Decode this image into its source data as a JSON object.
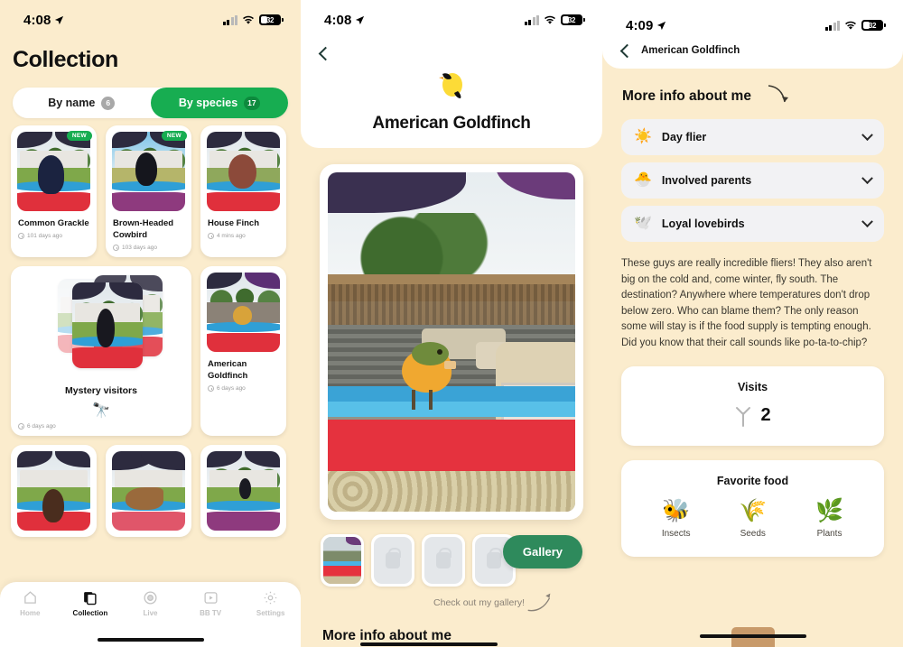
{
  "status_bar": {
    "time_left": "4:08",
    "time_mid": "4:08",
    "time_right": "4:09",
    "battery": "32",
    "location_icon": "location-arrow-icon",
    "signal_icon": "cellular-bars-icon",
    "wifi_icon": "wifi-icon"
  },
  "collection": {
    "title": "Collection",
    "segments": [
      {
        "label": "By name",
        "badge": "6",
        "active": false
      },
      {
        "label": "By species",
        "badge": "17",
        "active": true
      }
    ],
    "cards": [
      {
        "name": "Common Grackle",
        "time": "101 days ago",
        "badge": "NEW"
      },
      {
        "name": "Brown-Headed Cowbird",
        "time": "103 days ago",
        "badge": "NEW"
      },
      {
        "name": "House Finch",
        "time": "4 mins ago",
        "badge": ""
      },
      {
        "name": "Mystery visitors",
        "time": "6 days ago",
        "badge": "",
        "icon": "binoculars-icon"
      },
      {
        "name": "American Goldfinch",
        "time": "6 days ago",
        "badge": ""
      }
    ],
    "tabs": [
      {
        "label": "Home",
        "icon": "home-icon",
        "active": false
      },
      {
        "label": "Collection",
        "icon": "cards-icon",
        "active": true
      },
      {
        "label": "Live",
        "icon": "live-camera-icon",
        "active": false
      },
      {
        "label": "BB TV",
        "icon": "play-box-icon",
        "active": false
      },
      {
        "label": "Settings",
        "icon": "gear-icon",
        "active": false
      }
    ]
  },
  "detail": {
    "back_icon": "chevron-left-icon",
    "bird_emoji": "🐦",
    "title": "American Goldfinch",
    "gallery_button": "Gallery",
    "gallery_hint": "Check out my gallery!",
    "more_info_heading": "More info about me",
    "thumbnails": [
      {
        "state": "filled"
      },
      {
        "state": "locked"
      },
      {
        "state": "locked"
      },
      {
        "state": "locked"
      }
    ]
  },
  "info": {
    "back_title": "American Goldfinch",
    "heading": "More info about me",
    "accordions": [
      {
        "emoji": "☀️",
        "label": "Day flier",
        "icon": "sun-icon",
        "chevron": "chevron-down-icon"
      },
      {
        "emoji": "🐣",
        "label": "Involved parents",
        "icon": "hatching-chick-icon",
        "chevron": "chevron-down-icon"
      },
      {
        "emoji": "🕊️",
        "label": "Loyal lovebirds",
        "icon": "lovebirds-icon",
        "chevron": "chevron-down-icon"
      }
    ],
    "paragraph": "These guys are really incredible fliers! They also aren't big on the cold and, come winter, fly south. The destination? Anywhere where temperatures don't drop below zero. Who can blame them? The only reason some will stay is if the food supply is tempting enough. Did you know that their call sounds like po-ta-to-chip?",
    "visits": {
      "title": "Visits",
      "count": "2",
      "icon": "bird-foot-icon"
    },
    "favorite_food": {
      "title": "Favorite food",
      "items": [
        {
          "label": "Insects",
          "emoji": "🐝",
          "icon": "insect-icon"
        },
        {
          "label": "Seeds",
          "emoji": "🌾",
          "icon": "seeds-icon"
        },
        {
          "label": "Plants",
          "emoji": "🌿",
          "icon": "plant-icon"
        }
      ]
    }
  },
  "colors": {
    "background": "#fbeccd",
    "accent_green": "#17ad51",
    "gallery_green": "#2e8a5c"
  }
}
